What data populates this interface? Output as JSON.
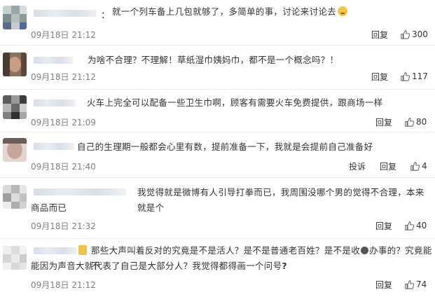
{
  "comments": [
    {
      "text": "就一个列车备上几包就够了，多简单的事，讨论来讨论去",
      "time": "09月18日 21:12",
      "reply_label": "回复",
      "like_count": "300",
      "emoji": "smiling-face-icon"
    },
    {
      "text": "为啥不合理？不理解！草纸湿巾姨妈巾，都不是一个概念吗？！",
      "time": "09月18日 21:12",
      "reply_label": "回复",
      "like_count": "117"
    },
    {
      "text": "火车上完全可以配备一些卫生巾啊，顾客有需要火车免费提供，跟商场一样",
      "time": "09月18日 21:09",
      "reply_label": "回复",
      "like_count": "80"
    },
    {
      "text": "自己的生理期一般都会心里有数，提前准备一下，我就是会提前自己准备好",
      "time": "09月18日 21:40",
      "report_label": "投诉",
      "reply_label": "回复",
      "like_count": "4"
    },
    {
      "text_line1": "我觉得就是微博有人引导打拳而已，我周围没哪个男的觉得不合理，本来就是个",
      "text_line2": "商品而已",
      "time": "09月18日 21:32",
      "reply_label": "回复",
      "like_count": "40"
    },
    {
      "text_line1_a": "那些大声叫着反对的究竟是不是活人？是不是普通老百姓？是不是收",
      "text_line1_b": "办事的？究竟能不",
      "text_line2": "能因为声音大就代表了自己是大部分人？我觉得都得画一个问号",
      "question_mark": "?",
      "time": "09月18日 21:12",
      "reply_label": "回复",
      "like_count": "74"
    }
  ],
  "icons": {
    "like": "thumbs-up-icon",
    "money": "money-bag-icon"
  },
  "colors": {
    "text": "#333333",
    "meta": "#808080",
    "separator": "#eeeeee"
  }
}
